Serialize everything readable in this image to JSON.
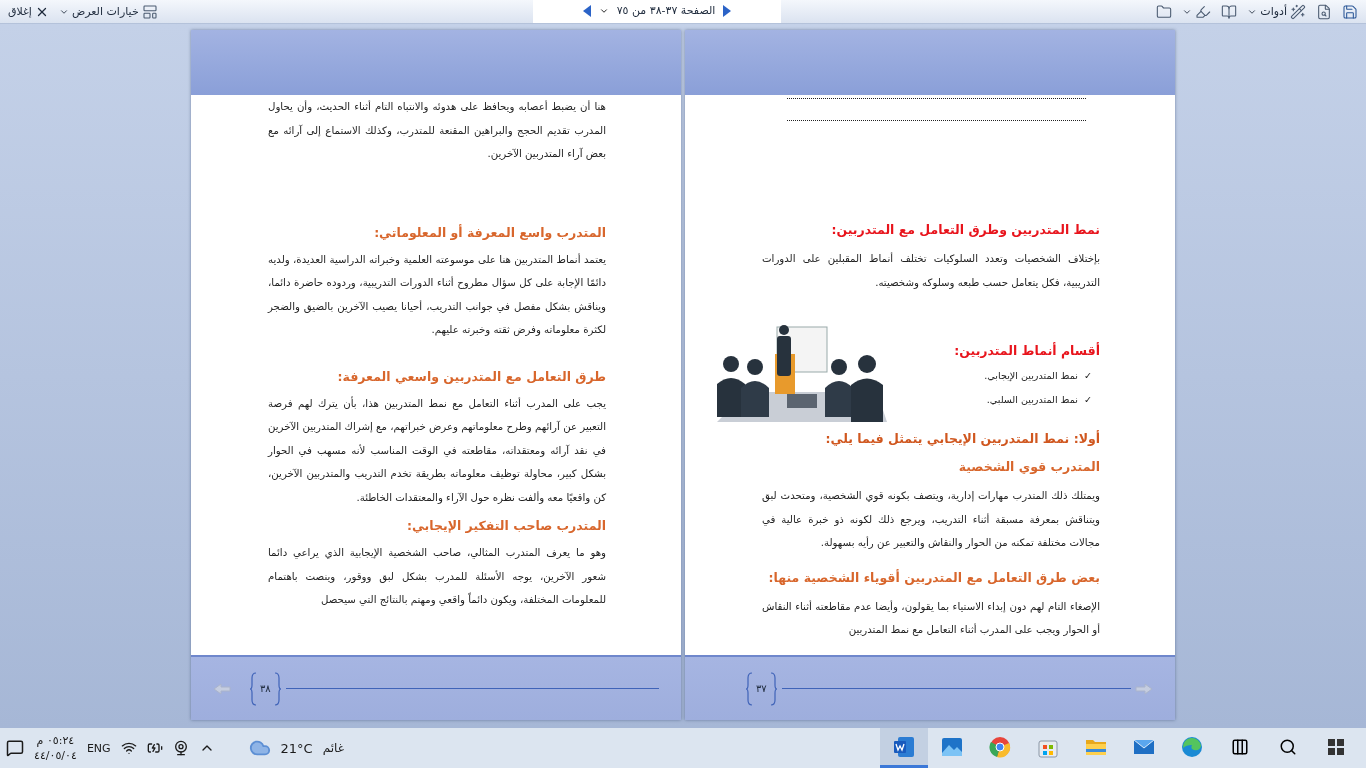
{
  "toolbar": {
    "right_tools": [
      {
        "kind": "save"
      },
      {
        "kind": "preview"
      },
      {
        "kind": "tools",
        "label": "أدوات"
      },
      {
        "kind": "research"
      },
      {
        "kind": "highlight"
      },
      {
        "kind": "folder"
      }
    ],
    "page_nav": "الصفحة ٣٧-٣٨ من ٧٥",
    "view_options": "خيارات العرض",
    "close": "إغلاق"
  },
  "pages": [
    {
      "number": "٣٧",
      "blocks": [
        {
          "kind": "dotted_line"
        },
        {
          "kind": "dotted_line"
        },
        {
          "kind": "heading",
          "color": "#e8141c",
          "text": "نمط المتدربين وطرق التعامل مع المتدربين:"
        },
        {
          "kind": "paragraph",
          "text": "بإختلاف الشخصيات وتعدد السلوكيات تختلف أنماط المقبلين على الدورات التدريبية، فكل يتعامل حسب طبعه وسلوكه وشخصيته."
        },
        {
          "kind": "illustrated",
          "heading": {
            "color": "#e8141c",
            "text": "أقسام أنماط المتدربين:"
          },
          "items": [
            {
              "marker": "✓",
              "text": "نمط المتدربين الإيجابي."
            },
            {
              "marker": "✓",
              "text": "نمط المتدربين السلبي."
            }
          ]
        },
        {
          "kind": "heading",
          "color": "#d0571f",
          "text": "أولا: نمط المتدربين الإيجابي يتمثل فيما يلي:"
        },
        {
          "kind": "heading",
          "color": "#d8662c",
          "text": "المتدرب قوي الشخصية"
        },
        {
          "kind": "paragraph",
          "text": "ويمتلك ذلك المتدرب مهارات إدارية، ويتصف بكونه قوي الشخصية، ومتحدث لبق ويتناقش بمعرفة مسبقة أثناء التدريب، ويرجع ذلك لكونه ذو خبرة عالية في مجالات مختلفة تمكنه من الحوار والنقاش والتعبير عن رأيه بسهولة."
        },
        {
          "kind": "heading",
          "color": "#d8662c",
          "text": "بعض طرق التعامل مع المتدربين أقوياء الشخصية منها:"
        },
        {
          "kind": "paragraph",
          "text": "الإصغاء التام لهم دون إبداء الاستياء بما يقولون، وأيضا عدم مقاطعته أثناء النقاش أو الحوار ويجب على المدرب أثناء التعامل مع نمط المتدربين"
        }
      ]
    },
    {
      "number": "٣٨",
      "blocks": [
        {
          "kind": "paragraph",
          "text": "هنا أن يضبط أعصابه ويحافظ على هدوئه والانتباه التام أثناء الحديث، وأن يحاول المدرب تقديم الحجج والبراهين المقنعة للمتدرب، وكذلك الاستماع إلى آرائه مع بعض آراء المتدربين الآخرين."
        },
        {
          "kind": "heading",
          "color": "#d8662c",
          "text": "المتدرب واسع المعرفة أو المعلوماتي:"
        },
        {
          "kind": "paragraph",
          "text": "يعتمد أنماط المتدربين هنا على موسوعته العلمية وخبراته الدراسية العديدة، ولديه دائمًا الإجابة على كل سؤال مطروح أثناء الدورات التدريبية، وردوده حاضرة دائما، ويناقش بشكل مفصل في جوانب التدريب، أحيانا يصيب الآخرين بالضيق والضجر لكثرة معلوماته وفرض ثقته وخبرته عليهم."
        },
        {
          "kind": "heading",
          "color": "#d8662c",
          "text": "طرق التعامل مع المتدربين واسعي المعرفة:"
        },
        {
          "kind": "paragraph",
          "text": "يجب على المدرب أثناء التعامل مع نمط المتدربين هذا، بأن يترك لهم فرصة التعبير عن آرائهم وطرح معلوماتهم وعرض خبراتهم، مع إشراك المتدربين الآخرين في نقد آرائه ومعتقداته، مقاطعته في الوقت المناسب لأنه مسهب في الحوار بشكل كبير، محاولة توظيف معلوماته بطريقة تخدم التدريب والمتدربين الآخرين، كن واقعيًا معه وألفت نظره حول الآراء والمعتقدات الخاطئة."
        },
        {
          "kind": "heading",
          "color": "#d8662c",
          "text": "المتدرب صاحب التفكير الإيجابي:"
        },
        {
          "kind": "paragraph",
          "text": "وهو ما يعرف المتدرب المثالي، صاحب الشخصية الإيجابية الذي يراعي دائما شعور الآخرين، يوجه الأسئلة للمدرب بشكل لبق ووقور، وينصت باهتمام للمعلومات المختلفة، ويكون دائماً واقعي ومهتم بالنتائج التي سيحصل"
        }
      ]
    }
  ],
  "taskbar": {
    "time": "٠٥:٢٤ م",
    "date": "٤٤/٠٥/٠٤",
    "language": "ENG",
    "temperature": "21°C",
    "weather": "غائم",
    "apps": [
      {
        "kind": "word",
        "selected": true
      },
      {
        "kind": "photos",
        "selected": false
      },
      {
        "kind": "chrome",
        "selected": false
      },
      {
        "kind": "store",
        "selected": false
      },
      {
        "kind": "explorer",
        "selected": false
      },
      {
        "kind": "mail",
        "selected": false
      },
      {
        "kind": "edge",
        "selected": false
      }
    ]
  }
}
